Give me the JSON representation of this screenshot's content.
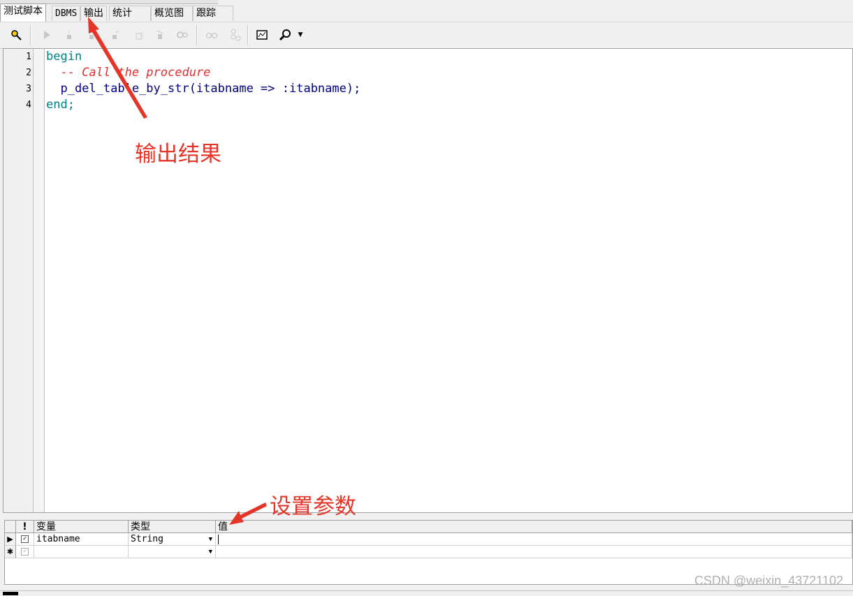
{
  "tabs": [
    {
      "label": "测试脚本",
      "active": true
    },
    {
      "label": "DBMS",
      "active": false
    },
    {
      "label": "输出",
      "active": false
    },
    {
      "label": "统计",
      "active": false
    },
    {
      "label": "概览图",
      "active": false
    },
    {
      "label": "跟踪",
      "active": false
    }
  ],
  "toolbar": {
    "icons": [
      "debug-icon",
      "run-icon",
      "step-into-icon",
      "step-over-icon",
      "step-out-icon",
      "run-to-exception-icon",
      "stop-icon",
      "breakpoint-settings-icon",
      "watch-icon",
      "variables-icon",
      "screenshot-icon",
      "find-icon"
    ]
  },
  "editor": {
    "line_numbers": [
      "1",
      "2",
      "3",
      "4"
    ],
    "lines": {
      "l1_kw": "begin",
      "l2_comment": "  -- Call the procedure",
      "l3_code": "  p_del_table_by_str(itabname => :itabname);",
      "l4_kw": "end;"
    }
  },
  "params": {
    "headers": {
      "flag": "!",
      "variable": "变量",
      "type": "类型",
      "value": "值"
    },
    "rows": [
      {
        "indicator": "▶",
        "checked": true,
        "variable": "itabname",
        "type": "String",
        "value": ""
      },
      {
        "indicator": "✱",
        "checked": true,
        "variable": "",
        "type": "",
        "value": ""
      }
    ]
  },
  "annotations": {
    "output_label": "输出结果",
    "params_label": "设置参数",
    "color": "#e53529"
  },
  "watermark": "CSDN @weixin_43721102"
}
